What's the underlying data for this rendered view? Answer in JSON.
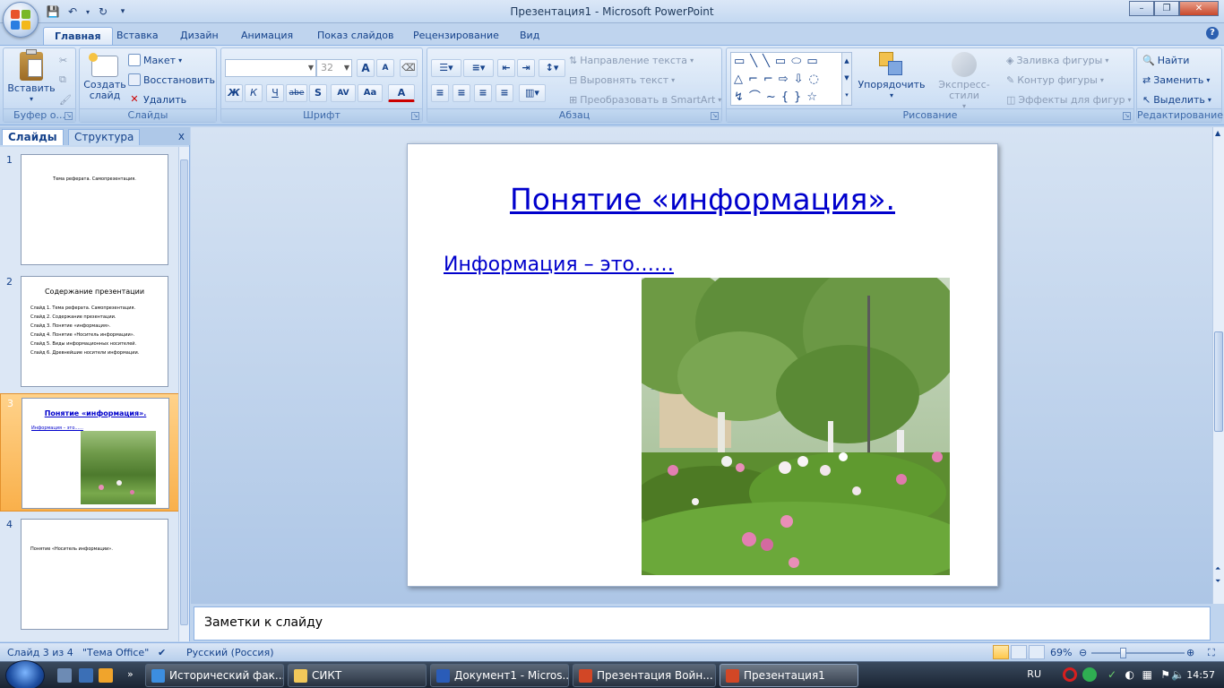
{
  "app": {
    "title": "Презентация1 - Microsoft PowerPoint",
    "window_controls": {
      "min": "–",
      "max": "❐",
      "close": "✕"
    }
  },
  "ribbon": {
    "tabs": [
      "Главная",
      "Вставка",
      "Дизайн",
      "Анимация",
      "Показ слайдов",
      "Рецензирование",
      "Вид"
    ],
    "active_tab": "Главная",
    "clipboard": {
      "paste": "Вставить",
      "label": "Буфер о..."
    },
    "slides": {
      "new_slide_line1": "Создать",
      "new_slide_line2": "слайд",
      "layout": "Макет",
      "reset": "Восстановить",
      "delete": "Удалить",
      "label": "Слайды"
    },
    "font": {
      "font_name": "",
      "font_size": "32",
      "label": "Шрифт",
      "bold": "Ж",
      "italic": "К",
      "underline": "Ч",
      "strike": "abe",
      "shadow": "S",
      "spacing": "AV",
      "case": "Aa",
      "color": "A",
      "grow": "A",
      "shrink": "A"
    },
    "paragraph": {
      "text_direction": "Направление текста",
      "align_text": "Выровнять текст",
      "smartart": "Преобразовать в SmartArt",
      "label": "Абзац"
    },
    "drawing": {
      "arrange": "Упорядочить",
      "quick_styles": "Экспресс-стили",
      "fill": "Заливка фигуры",
      "outline": "Контур фигуры",
      "effects": "Эффекты для фигур",
      "label": "Рисование"
    },
    "editing": {
      "find": "Найти",
      "replace": "Заменить",
      "select": "Выделить",
      "label": "Редактирование"
    }
  },
  "left_pane": {
    "tab_slides": "Слайды",
    "tab_outline": "Структура",
    "close": "x",
    "thumbnails": [
      {
        "num": "1",
        "title": "Тема реферата. Самопрезентация."
      },
      {
        "num": "2",
        "title": "Содержание презентации",
        "lines": [
          "Слайд 1. Тема реферата. Самопрезентация.",
          "Слайд 2. Содержание презентации.",
          "Слайд 3. Понятие «информация».",
          "Слайд 4. Понятие «Носитель информации».",
          "Слайд 5. Виды информационных носителей.",
          "Слайд 6. Древнейшие носители информации."
        ]
      },
      {
        "num": "3",
        "title": "Понятие «информация».",
        "body": "Информация – это......"
      },
      {
        "num": "4",
        "title": "Понятие «Носитель информации»."
      }
    ]
  },
  "slide": {
    "title": "Понятие «информация».",
    "body": "Информация – это……"
  },
  "notes": {
    "placeholder": "Заметки к слайду"
  },
  "status": {
    "slide_pos": "Слайд 3 из 4",
    "theme": "\"Тема Office\"",
    "language": "Русский (Россия)",
    "zoom": "69%"
  },
  "taskbar": {
    "tasks": [
      "Исторический фак...",
      "СИКТ",
      "Документ1 - Micros...",
      "Презентация Войн...",
      "Презентация1"
    ],
    "lang": "RU",
    "clock": "14:57"
  },
  "colors": {
    "accent": "#15428b",
    "slide_text": "#0000cc",
    "selected_thumb": "#f9b04b"
  }
}
